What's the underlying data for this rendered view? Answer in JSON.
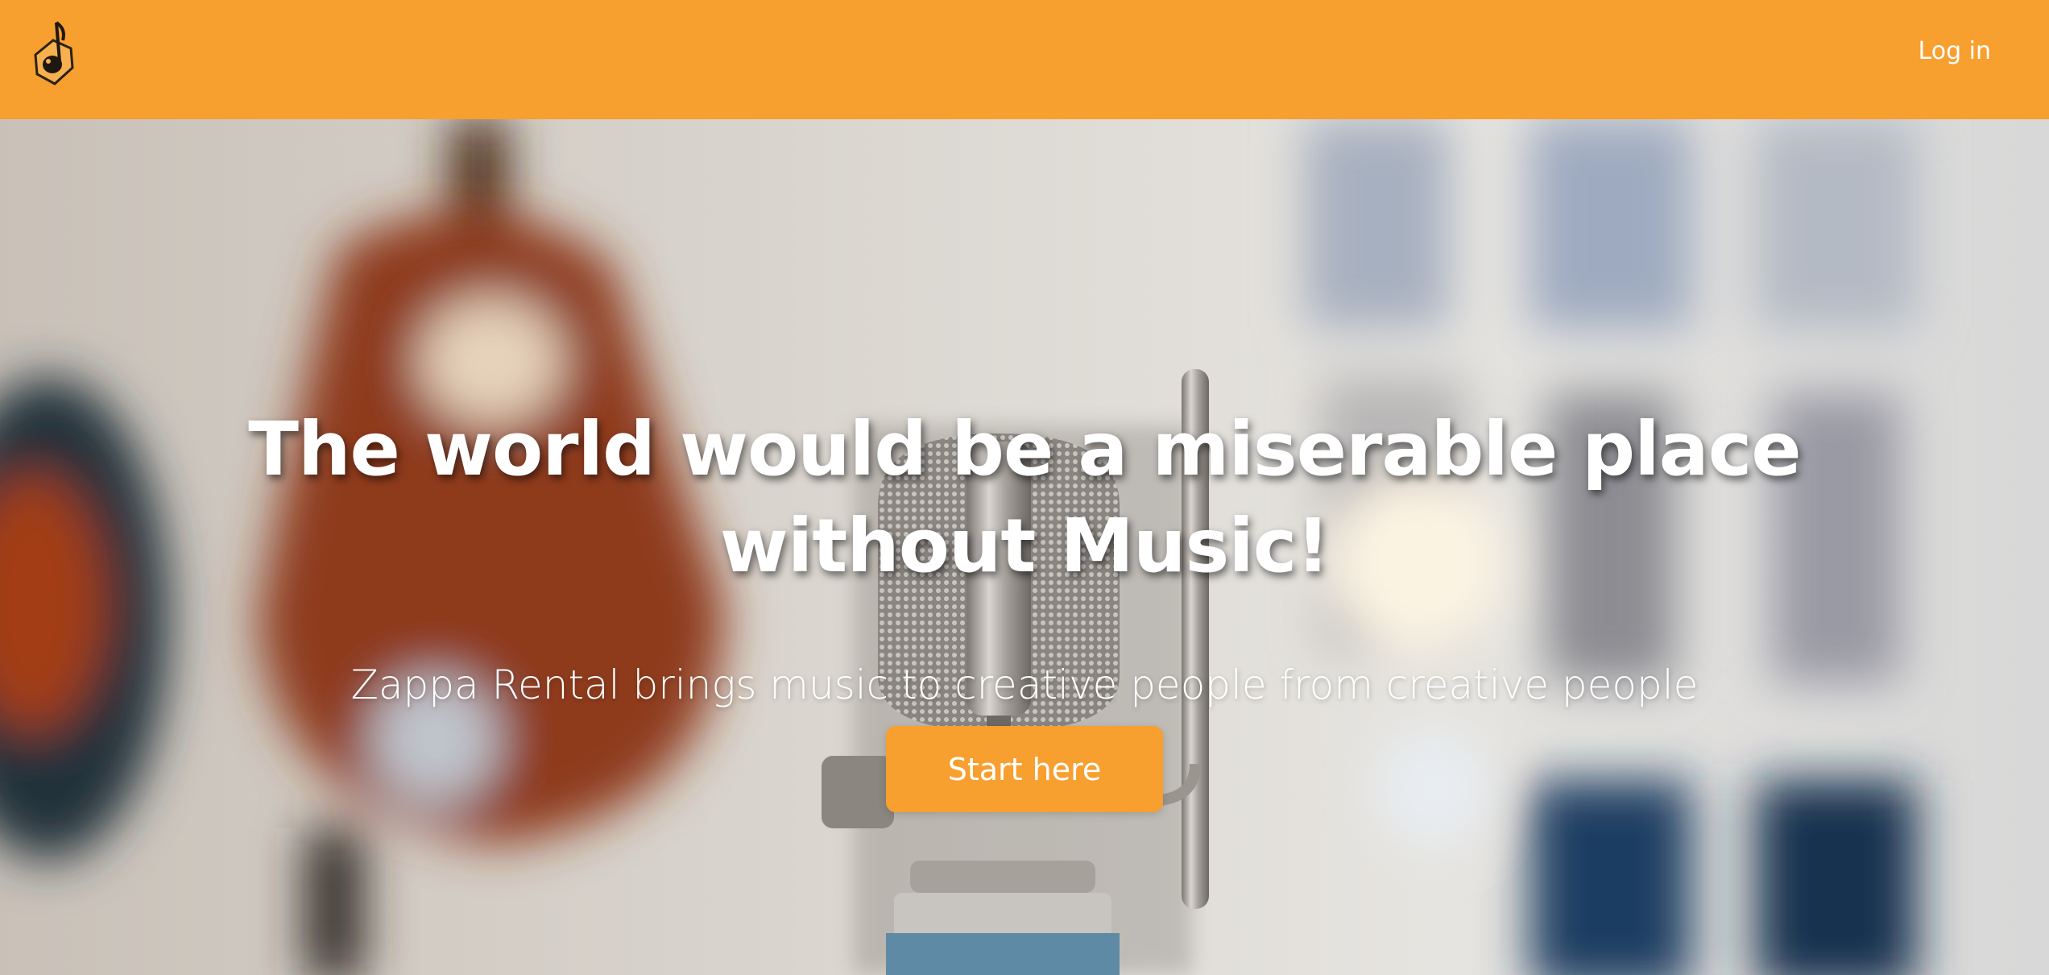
{
  "navbar": {
    "logo_icon": "music-note-logo-icon",
    "login_label": "Log in"
  },
  "hero": {
    "background_image": "microphone-studio-photo",
    "headline": "The world would be a miserable place without Music!",
    "subtitle": "Zappa Rental brings music to creative people from creative people",
    "cta_label": "Start here"
  },
  "colors": {
    "brand_orange": "#F79F2F",
    "text_white": "#FFFFFF"
  }
}
